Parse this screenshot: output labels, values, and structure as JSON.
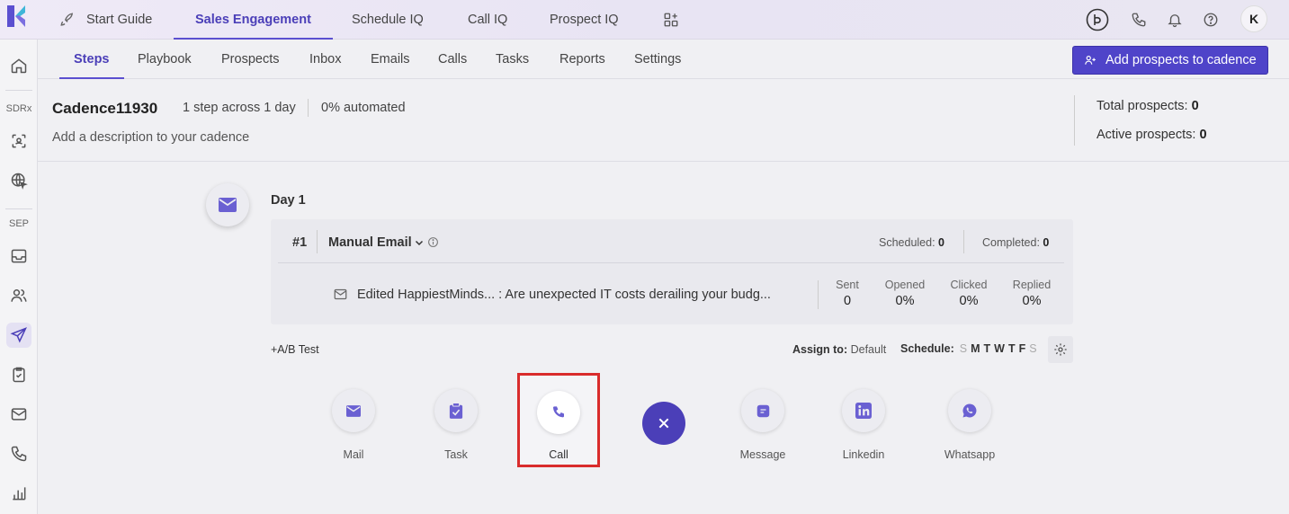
{
  "topnav": {
    "items": [
      {
        "label": "Start Guide",
        "active": false
      },
      {
        "label": "Sales Engagement",
        "active": true
      },
      {
        "label": "Schedule IQ",
        "active": false
      },
      {
        "label": "Call IQ",
        "active": false
      },
      {
        "label": "Prospect IQ",
        "active": false
      }
    ],
    "avatar_initial": "K",
    "accent_color": "#4b3fb8"
  },
  "sidebar": {
    "sections": [
      {
        "label": "SDRx"
      },
      {
        "label": "SEP"
      }
    ]
  },
  "subnav": {
    "tabs": [
      {
        "label": "Steps",
        "active": true
      },
      {
        "label": "Playbook"
      },
      {
        "label": "Prospects"
      },
      {
        "label": "Inbox"
      },
      {
        "label": "Emails"
      },
      {
        "label": "Calls"
      },
      {
        "label": "Tasks"
      },
      {
        "label": "Reports"
      },
      {
        "label": "Settings"
      }
    ],
    "add_button_label": "Add prospects to cadence"
  },
  "cadence": {
    "name": "Cadence11930",
    "steps_summary": "1 step across 1 day",
    "automation": "0% automated",
    "description_placeholder": "Add a description to your cadence",
    "total_prospects_label": "Total prospects:",
    "total_prospects_value": "0",
    "active_prospects_label": "Active prospects:",
    "active_prospects_value": "0"
  },
  "day": {
    "label": "Day 1",
    "step": {
      "number": "#1",
      "type": "Manual Email",
      "scheduled_label": "Scheduled:",
      "scheduled_value": "0",
      "completed_label": "Completed:",
      "completed_value": "0",
      "subject": "Edited HappiestMinds... : Are unexpected IT costs derailing your budg...",
      "metrics": [
        {
          "label": "Sent",
          "value": "0"
        },
        {
          "label": "Opened",
          "value": "0%"
        },
        {
          "label": "Clicked",
          "value": "0%"
        },
        {
          "label": "Replied",
          "value": "0%"
        }
      ]
    },
    "ab_test_label": "+A/B Test",
    "assign_label": "Assign to:",
    "assign_value": "Default",
    "schedule_label": "Schedule:",
    "schedule_days": [
      {
        "d": "S",
        "on": false
      },
      {
        "d": "M",
        "on": true
      },
      {
        "d": "T",
        "on": true
      },
      {
        "d": "W",
        "on": true
      },
      {
        "d": "T",
        "on": true
      },
      {
        "d": "F",
        "on": true
      },
      {
        "d": "S",
        "on": false
      }
    ]
  },
  "pickers": [
    {
      "label": "Mail",
      "icon": "mail-icon"
    },
    {
      "label": "Task",
      "icon": "clipboard-icon"
    },
    {
      "label": "Call",
      "icon": "phone-icon"
    },
    {
      "label": "Message",
      "icon": "message-icon"
    },
    {
      "label": "Linkedin",
      "icon": "linkedin-icon"
    },
    {
      "label": "Whatsapp",
      "icon": "whatsapp-icon"
    }
  ]
}
